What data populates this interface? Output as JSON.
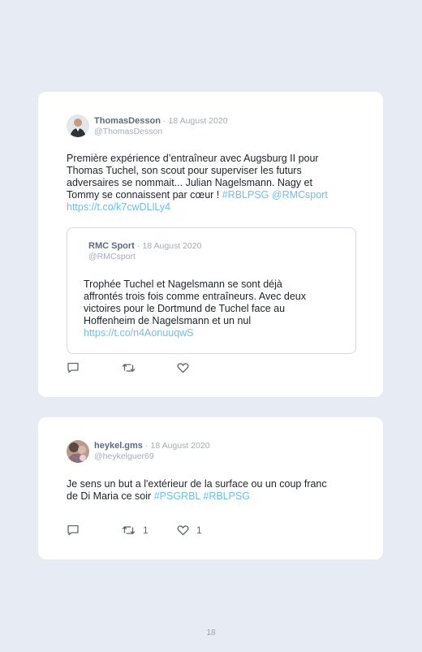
{
  "tweets": [
    {
      "author_name": "ThomasDesson",
      "separator": "·",
      "date": "18 August 2020",
      "handle": "@ThomasDesson",
      "text_lines": [
        "Première expérience d’entraîneur avec Augsburg II pour",
        "Thomas Tuchel, son scout pour superviser les futurs",
        "adversaires se nommait... Julian Nagelsmann. Nagy et",
        "Tommy se connaissent par cœur ! "
      ],
      "text_tags": "#RBLPSG @RMCsport",
      "text_link": "https://t.co/k7cwDLlLy4",
      "quoted": {
        "author_name": "RMC Sport",
        "separator": "·",
        "date": "18 August 2020",
        "handle": "@RMCsport",
        "text_lines": [
          "Trophée Tuchel et Nagelsmann se sont déjà",
          "affrontés trois fois comme entraîneurs. Avec deux",
          "victoires pour le Dortmund de Tuchel face au",
          "Hoffenheim de Nagelsmann et un nul"
        ],
        "text_link": "https://t.co/n4AonuuqwS"
      },
      "actions": {
        "reply_icon": "reply-icon",
        "retweet_icon": "retweet-icon",
        "like_icon": "heart-icon"
      }
    },
    {
      "author_name": "heykel.gms",
      "separator": "·",
      "date": "18 August 2020",
      "handle": "@heykelguer69",
      "text_lines": [
        "Je sens un but a l'extérieur de la surface ou un coup franc",
        "de Di Maria ce soir "
      ],
      "text_tags": "#PSGRBL #RBLPSG",
      "actions": {
        "reply_icon": "reply-icon",
        "retweet_icon": "retweet-icon",
        "like_icon": "heart-icon",
        "retweet_count": "1",
        "like_count": "1"
      }
    }
  ],
  "page_number": "18",
  "colors": {
    "background": "#e7ebf3",
    "card": "#ffffff",
    "link": "#6cc0e8",
    "name": "#5d6b7d",
    "meta": "#a3acb9"
  }
}
